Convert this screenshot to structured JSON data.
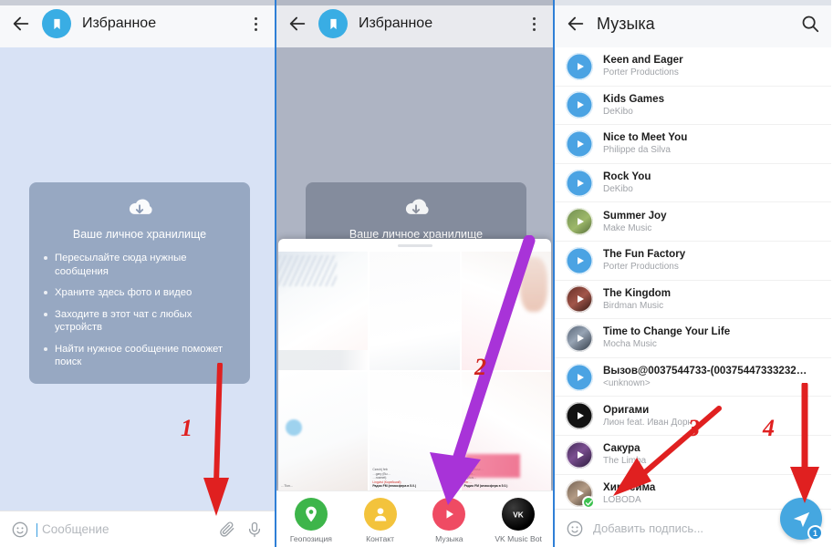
{
  "panels": [
    {
      "id": "saved-messages",
      "appbar": {
        "title": "Избранное",
        "back_icon": "arrow-left-icon",
        "avatar_icon": "bookmark-icon",
        "menu_icon": "kebab-menu-icon"
      },
      "saved_card": {
        "icon": "cloud-download-icon",
        "title": "Ваше личное хранилище",
        "bullets": [
          "Пересылайте сюда нужные сообщения",
          "Храните здесь фото и видео",
          "Заходите в этот чат с любых устройств",
          "Найти нужное сообщение поможет поиск"
        ]
      },
      "input_bar": {
        "emoji_icon": "smiley-icon",
        "placeholder": "Сообщение",
        "attach_icon": "paperclip-icon",
        "mic_icon": "microphone-icon"
      }
    },
    {
      "id": "attachment-picker",
      "appbar": {
        "title": "Избранное",
        "back_icon": "arrow-left-icon",
        "avatar_icon": "bookmark-icon",
        "menu_icon": "kebab-menu-icon"
      },
      "saved_card": {
        "icon": "cloud-download-icon",
        "title": "Ваше личное хранилище"
      },
      "attachments": [
        {
          "label": "Геопозиция",
          "icon": "location-pin-icon",
          "color": "#3db54a"
        },
        {
          "label": "Контакт",
          "icon": "person-icon",
          "color": "#f3c33c"
        },
        {
          "label": "Музыка",
          "icon": "play-icon",
          "color": "#ef4b63"
        },
        {
          "label": "VK Music Bot",
          "icon": "vk-icon",
          "color": "#000000"
        }
      ],
      "gallery_caption_lines": {
        "l1": "…Tion…",
        "l2": "Czech( feb",
        "l3": "…gary (Bu…",
        "l4": "…roamet)",
        "l5": "Lingvist (Корейский)",
        "l6": "Радио FM (атмосфера в 5.0.)",
        "r1": "Mos…",
        "r2": "…ish (Mosc…",
        "r3": "…Cze…",
        "r4": "…(Aus…",
        "r5": "Ter…",
        "r6": "Радио FM (атмосфера в 5.0.)"
      }
    },
    {
      "id": "music-picker",
      "appbar": {
        "title": "Музыка",
        "back_icon": "arrow-left-icon",
        "search_icon": "search-icon"
      },
      "tracks": [
        {
          "title": "Keen and Eager",
          "artist": "Porter Productions",
          "art": "blue",
          "selected": false
        },
        {
          "title": "Kids Games",
          "artist": "DeKibo",
          "art": "blue",
          "selected": false
        },
        {
          "title": "Nice to Meet You",
          "artist": "Philippe da Silva",
          "art": "blue",
          "selected": false
        },
        {
          "title": "Rock You",
          "artist": "DeKibo",
          "art": "blue",
          "selected": false
        },
        {
          "title": "Summer Joy",
          "artist": "Make Music",
          "art": "img1",
          "selected": false
        },
        {
          "title": "The Fun Factory",
          "artist": "Porter Productions",
          "art": "blue",
          "selected": false
        },
        {
          "title": "The Kingdom",
          "artist": "Birdman Music",
          "art": "img2",
          "selected": false
        },
        {
          "title": "Time to Change Your Life",
          "artist": "Mocha Music",
          "art": "img3",
          "selected": false
        },
        {
          "title": "Вызов@0037544733-(00375447333232…",
          "artist": "<unknown>",
          "art": "blue",
          "selected": false
        },
        {
          "title": "Оригами",
          "artist": "Лион feat. Иван Дорн",
          "art": "img4",
          "selected": false
        },
        {
          "title": "Сакура",
          "artist": "The Limba",
          "art": "img5",
          "selected": false
        },
        {
          "title": "Хиросима",
          "artist": "LOBODA",
          "art": "img6",
          "selected": true
        }
      ],
      "caption_bar": {
        "emoji_icon": "smiley-icon",
        "placeholder": "Добавить подпись...",
        "send_icon": "send-icon",
        "badge": "1"
      }
    }
  ],
  "annotations": [
    {
      "number": "1",
      "color": "#e02020",
      "target": "paperclip-icon"
    },
    {
      "number": "2",
      "color": "#d0241f",
      "target": "music-attachment-button"
    },
    {
      "number": "3",
      "color": "#e02020",
      "target": "track-row-selected"
    },
    {
      "number": "4",
      "color": "#e02020",
      "target": "send-button"
    }
  ],
  "colors": {
    "accent_blue": "#45a7e0",
    "panel_bg": "#d8e2f5",
    "panel_bg_dim": "#aeb4c3",
    "arrow_red": "#e02020",
    "arrow_purple": "#a833d8",
    "check_green": "#3dc14f"
  }
}
